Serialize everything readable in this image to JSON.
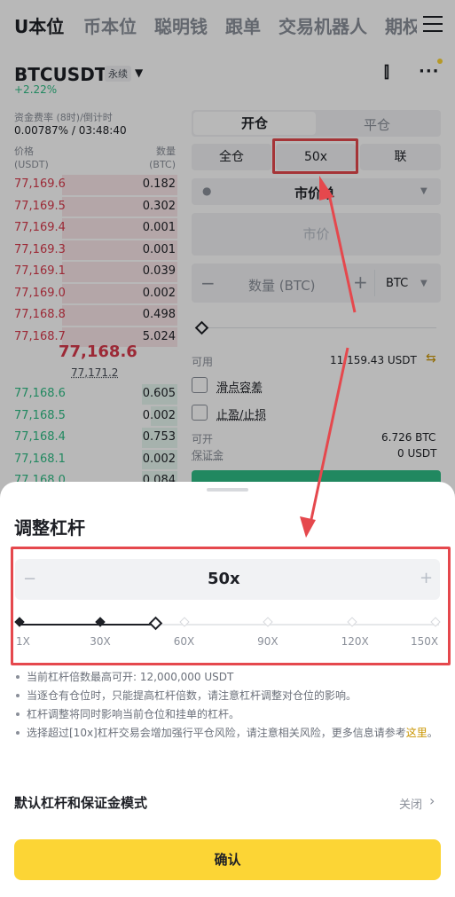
{
  "nav": {
    "tabs": [
      "U本位",
      "币本位",
      "聪明钱",
      "跟单",
      "交易机器人",
      "期权"
    ]
  },
  "symbol": {
    "name": "BTCUSDT",
    "type": "永续",
    "change": "+2.22%"
  },
  "funding": {
    "label": "资金费率 (8时)/倒计时",
    "value": "0.00787% / 03:48:40"
  },
  "orderbook": {
    "price_header": "价格",
    "price_unit": "(USDT)",
    "qty_header": "数量",
    "qty_unit": "(BTC)",
    "asks": [
      [
        "77,169.6",
        "0.182"
      ],
      [
        "77,169.5",
        "0.302"
      ],
      [
        "77,169.4",
        "0.001"
      ],
      [
        "77,169.3",
        "0.001"
      ],
      [
        "77,169.1",
        "0.039"
      ],
      [
        "77,169.0",
        "0.002"
      ],
      [
        "77,168.8",
        "0.498"
      ],
      [
        "77,168.7",
        "5.024"
      ]
    ],
    "last_price": "77,168.6",
    "mark_price": "77,171.2",
    "bids": [
      [
        "77,168.6",
        "0.605"
      ],
      [
        "77,168.5",
        "0.002"
      ],
      [
        "77,168.4",
        "0.753"
      ],
      [
        "77,168.1",
        "0.002"
      ],
      [
        "77,168.0",
        "0.084"
      ]
    ]
  },
  "order": {
    "open_label": "开仓",
    "close_label": "平仓",
    "margin_mode": "全仓",
    "leverage": "50x",
    "assets_mode": "联",
    "order_type": "市价单",
    "price_placeholder": "市价",
    "qty_placeholder": "数量 (BTC)",
    "qty_unit": "BTC",
    "available_label": "可用",
    "available_value": "11,159.43 USDT",
    "slippage_label": "滑点容差",
    "tpsl_label": "止盈/止损",
    "can_open_label": "可开",
    "can_open_value": "6.726 BTC",
    "margin_label": "保证金",
    "margin_value": "0 USDT"
  },
  "sheet": {
    "title": "调整杠杆",
    "leverage_value": "50x",
    "minus": "−",
    "plus": "+",
    "leverage_level": 50,
    "ticks": [
      "1X",
      "30X",
      "60X",
      "90X",
      "120X",
      "150X"
    ],
    "notes": [
      "当前杠杆倍数最高可开: 12,000,000 USDT",
      "当逐仓有仓位时，只能提高杠杆倍数，请注意杠杆调整对仓位的影响。",
      "杠杆调整将同时影响当前仓位和挂单的杠杆。"
    ],
    "note4_prefix": "选择超过[10x]杠杆交易会增加强行平仓风险，请注意相关风险，更多信息请参考",
    "note4_link": "这里",
    "note4_suffix": "。",
    "default_label": "默认杠杆和保证金模式",
    "default_value": "关闭",
    "confirm_label": "确认"
  },
  "colors": {
    "ask": "#d9394b",
    "bid": "#2ebd85",
    "accent": "#fcd535",
    "highlight": "#e5484d",
    "link": "#c99400"
  }
}
